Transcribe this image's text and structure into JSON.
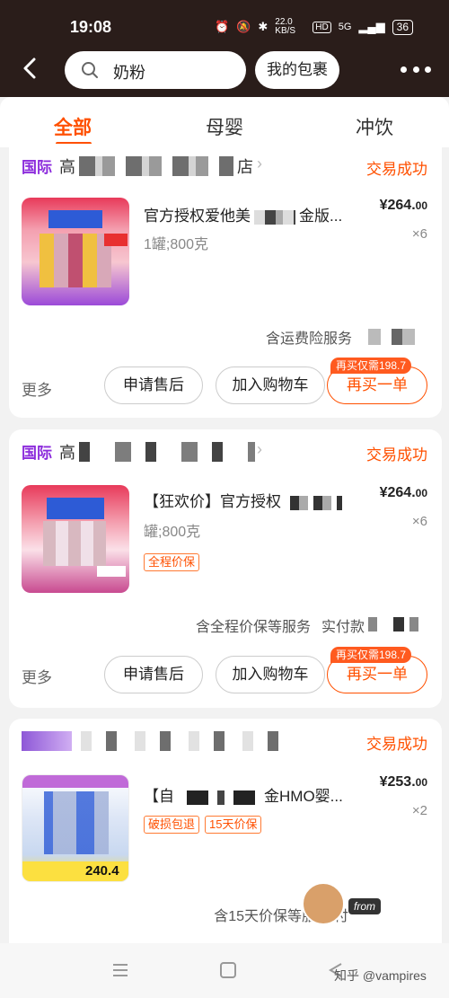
{
  "status_bar": {
    "time": "19:08",
    "speed": "22.0 KB/S",
    "network": "5G",
    "battery": "36"
  },
  "search": {
    "query": "奶粉",
    "package_label": "我的包裹"
  },
  "tabs": [
    {
      "label": "全部",
      "active": true
    },
    {
      "label": "母婴",
      "active": false
    },
    {
      "label": "冲饮",
      "active": false
    }
  ],
  "orders": [
    {
      "shop_prefix": "国际",
      "shop_first_char": "高",
      "shop_suffix": "店",
      "status": "交易成功",
      "title": "官方授权爱他美",
      "title_tail": "金版...",
      "spec": "1罐;800克",
      "price": "¥264.",
      "price_cents": "00",
      "qty": "×6",
      "tags": [],
      "service": "含运费险服务",
      "paid": "实付",
      "more": "更多",
      "btn_after_sale": "申请售后",
      "btn_cart": "加入购物车",
      "btn_rebuy": "再买一单",
      "promo": "再买仅需198.7"
    },
    {
      "shop_prefix": "国际",
      "shop_first_char": "高",
      "shop_suffix": "",
      "status": "交易成功",
      "title": "【狂欢价】官方授权",
      "title_tail": "",
      "spec": "罐;800克",
      "price": "¥264.",
      "price_cents": "00",
      "qty": "×6",
      "tags": [
        "全程价保"
      ],
      "service": "含全程价保等服务",
      "paid": "实付款",
      "more": "更多",
      "btn_after_sale": "申请售后",
      "btn_cart": "加入购物车",
      "btn_rebuy": "再买一单",
      "promo": "再买仅需198.7"
    },
    {
      "shop_prefix": "",
      "shop_first_char": "",
      "shop_suffix": "",
      "status": "交易成功",
      "title": "【自",
      "title_tail": "金HMO婴...",
      "spec": "",
      "price": "¥253.",
      "price_cents": "00",
      "qty": "×2",
      "tags": [
        "破损包退",
        "15天价保"
      ],
      "service": "含15天价保等服务",
      "paid": "付",
      "thumb_price": "240.4"
    }
  ],
  "overlay": {
    "from": "from",
    "watermark": "知乎 @vampires"
  },
  "colors": {
    "accent": "#ff5000",
    "header_bg": "#2a1d1a",
    "intl_purple": "#8c2cdc"
  }
}
